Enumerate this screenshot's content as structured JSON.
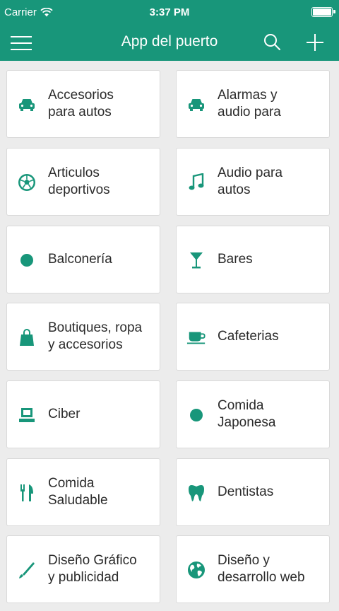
{
  "status_bar": {
    "carrier": "Carrier",
    "time": "3:37 PM"
  },
  "nav_bar": {
    "title": "App del puerto"
  },
  "accent_color": "#18967a",
  "categories": [
    {
      "label": "Accesorios\npara autos",
      "icon": "car-icon"
    },
    {
      "label": "Alarmas y\naudio para",
      "icon": "car-icon"
    },
    {
      "label": "Articulos\ndeportivos",
      "icon": "soccer-ball-icon"
    },
    {
      "label": "Audio para\nautos",
      "icon": "music-note-icon"
    },
    {
      "label": "Balconería",
      "icon": "dot-icon"
    },
    {
      "label": "Bares",
      "icon": "cocktail-glass-icon"
    },
    {
      "label": "Boutiques, ropa\ny accesorios",
      "icon": "shopping-bag-icon"
    },
    {
      "label": "Cafeterias",
      "icon": "coffee-cup-icon"
    },
    {
      "label": "Ciber",
      "icon": "computer-icon"
    },
    {
      "label": "Comida\nJaponesa",
      "icon": "dot-icon"
    },
    {
      "label": "Comida\nSaludable",
      "icon": "fork-knife-icon"
    },
    {
      "label": "Dentistas",
      "icon": "tooth-icon"
    },
    {
      "label": "Diseño Gráfico\ny publicidad",
      "icon": "pen-brush-icon"
    },
    {
      "label": "Diseño y\ndesarrollo web",
      "icon": "globe-icon"
    }
  ]
}
